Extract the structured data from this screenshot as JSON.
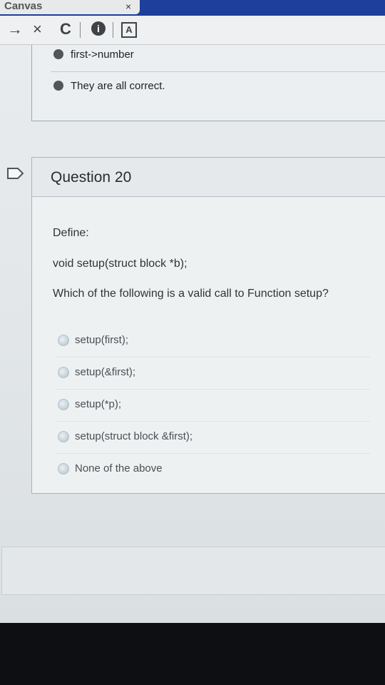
{
  "browser": {
    "tab_title": "Canvas",
    "tab_close": "×",
    "toolbar": {
      "forward": "→",
      "stop": "×",
      "reload": "C",
      "info": "i",
      "reader": "A"
    }
  },
  "previous_question": {
    "answers": [
      "first->number",
      "They are all correct."
    ]
  },
  "question": {
    "title": "Question 20",
    "lines": [
      "Define:",
      "void setup(struct block *b);",
      "Which of the following is a valid call to Function setup?"
    ],
    "answers": [
      "setup(first);",
      "setup(&first);",
      "setup(*p);",
      "setup(struct block &first);",
      "None of the above"
    ]
  }
}
